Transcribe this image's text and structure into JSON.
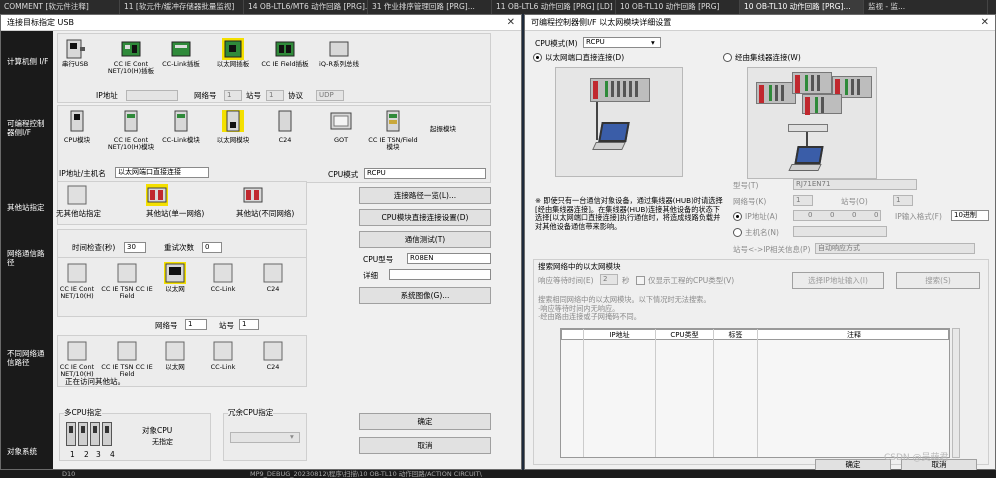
{
  "taskbar": {
    "tabs": [
      "COMMENT [软元件注释]",
      "11 [软元件/缓冲存储器批量监视]",
      "14 OB-LTL6/MT6 动作回路 [PRG]...",
      "31 作业排序管理回路 [PRG]...",
      "11 OB-LTL6 动作回路 [PRG] [LD]",
      "10 OB-TL10 动作回路 [PRG]",
      "10 OB-TL10 动作回路 [PRG]...",
      "监视 - 监..."
    ]
  },
  "bottom_status": {
    "left": "D10",
    "middle": "MP9_DEBUG_20230812\\程序\\扫描\\10 OB-TL10 动作回路/ACTION CIRCUIT\\"
  },
  "left_dialog": {
    "title": "连接目标指定 USB",
    "nav": {
      "pc_side": "计算机侧 I/F",
      "plc_side": "可编程控制器侧I/F",
      "other_station": "其他站指定",
      "network_route": "网络通信路径",
      "diff_network": "不同网络通信路径",
      "target_system": "对象系统"
    },
    "pc_icons": [
      "串行USB",
      "CC IE Cont NET/10(H)插板",
      "CC-Link插板",
      "以太网插板",
      "CC IE Field插板",
      "iQ-R系列总线"
    ],
    "pc_fields": {
      "ip_label": "IP地址",
      "ip_value": "",
      "net_label": "网络号",
      "net_value": "1",
      "station_label": "站号",
      "station_value": "1",
      "protocol_label": "协议",
      "protocol_value": "UDP"
    },
    "plc_icons": [
      "CPU模块",
      "CC IE Cont NET/10(H)模块",
      "CC-Link模块",
      "以太网模块",
      "C24",
      "GOT",
      "CC IE TSN/Field模块",
      "起振模块"
    ],
    "cpu_mode": {
      "label": "CPU模式",
      "value": "RCPU"
    },
    "host": {
      "label": "IP地址/主机名",
      "value": "以太网端口直接连接"
    },
    "other_icons": [
      "无其他站指定",
      "其他站(单一网络)",
      "其他站(不同网络)"
    ],
    "timeout": {
      "label": "时间检查(秒)",
      "value": "30"
    },
    "retry": {
      "label": "重试次数",
      "value": "0"
    },
    "buttons": {
      "route_list": "连接路径一览(L)...",
      "direct_setting": "CPU模块直接连接设置(D)",
      "comm_test": "通信测试(T)",
      "system_image": "系统图像(G)...",
      "ok": "确定",
      "cancel": "取消"
    },
    "cpu_type": {
      "label": "CPU型号",
      "value": "R08EN"
    },
    "detail": {
      "label": "详细",
      "value": ""
    },
    "route_icons": [
      "CC IE Cont NET/10(H)",
      "CC IE TSN CC IE Field",
      "以太网",
      "CC-Link",
      "C24"
    ],
    "net_station": {
      "net_label": "网络号",
      "net_value": "1",
      "station_label": "站号",
      "station_value": "1"
    },
    "diff_icons": [
      "CC IE Cont NET/10(H)",
      "CC IE TSN CC IE Field",
      "以太网",
      "CC-Link",
      "C24"
    ],
    "accessing": "正在访问其他站。",
    "multi_cpu": {
      "group": "多CPU指定",
      "target_label": "对象CPU",
      "target_value": "无指定",
      "numbers": [
        "1",
        "2",
        "3",
        "4"
      ]
    },
    "redundant": {
      "group": "冗余CPU指定"
    }
  },
  "right_dialog": {
    "title": "可编程控制器侧I/F 以太网模块详细设置",
    "cpu_mode": {
      "label": "CPU模式(M)",
      "value": "RCPU"
    },
    "radio_direct": "以太网端口直接连接(D)",
    "radio_hub": "经由集线器连接(W)",
    "note": "※ 即使只有一台通信对象设备，通过集线器(HUB)时请选择[经由集线器连接]。在集线器(HUB)连接其他设备的状态下选择[以太网端口直接连接]执行通信时，将造成线路负载并对其他设备通信带来影响。",
    "model": {
      "label": "型号(T)",
      "value": "RJ71EN71"
    },
    "net": {
      "label": "网络号(K)",
      "value": "1"
    },
    "station": {
      "label": "站号(O)",
      "value": "1"
    },
    "ip_radio": "IP地址(A)",
    "ip_value": [
      "0",
      "0",
      "0",
      "0"
    ],
    "ip_format": {
      "label": "IP输入格式(F)",
      "value": "10进制"
    },
    "host_radio": "主机名(N)",
    "station_ip": {
      "label": "站号<->IP相关信息(P)",
      "value": "自动响应方式"
    },
    "search": {
      "group": "搜索网络中的以太网模块",
      "wait_label": "响应等待时间(E)",
      "wait_value": "2",
      "wait_unit": "秒",
      "checkbox": "仅显示工程的CPU类型(V)",
      "select_ip_btn": "选择IP地址输入(I)",
      "search_btn": "搜索(S)",
      "hint": "搜索相同网络中的以太网模块。以下情况时无法搜索。\n·响应等待时间内无响应。\n·经由路由连接或子网掩码不同。",
      "columns": [
        "",
        "IP地址",
        "CPU类型",
        "标签",
        "注释"
      ]
    },
    "buttons": {
      "ok": "确定",
      "cancel": "取消"
    }
  },
  "watermark": "CSDN @吴萌君"
}
